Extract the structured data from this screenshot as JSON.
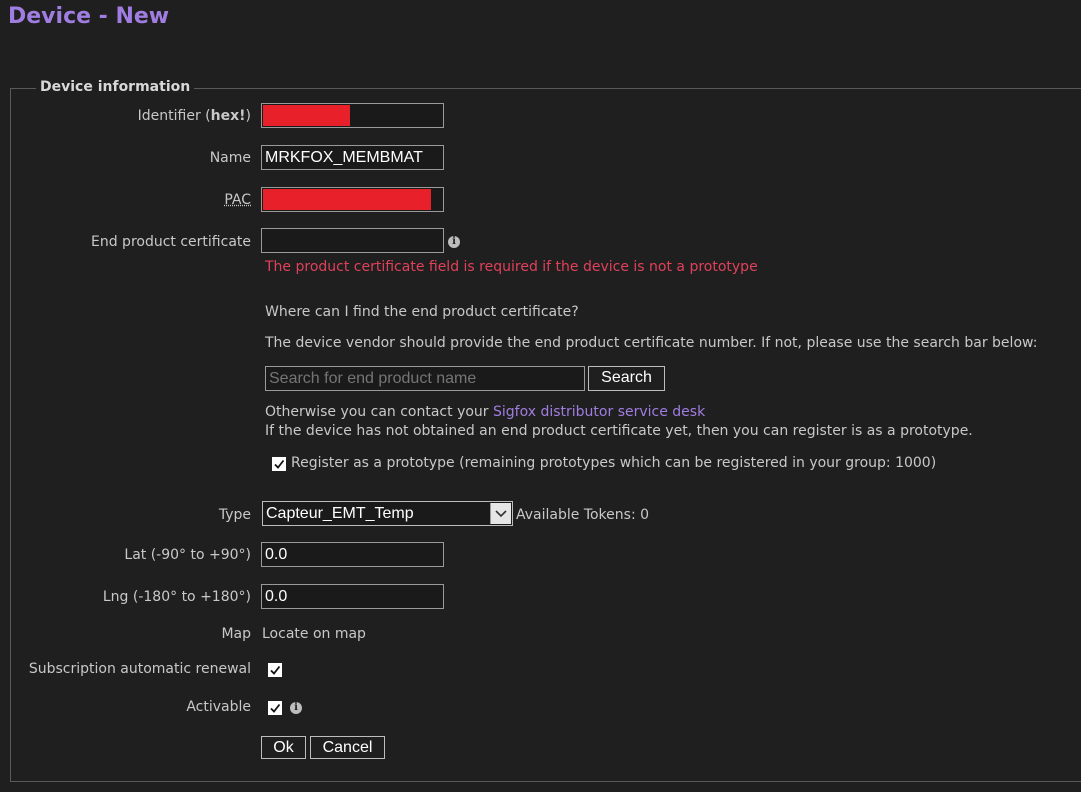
{
  "page": {
    "title": "Device - New"
  },
  "fieldset": {
    "legend": "Device information"
  },
  "identifier": {
    "label_prefix": "Identifier (",
    "label_bold": "hex!",
    "label_suffix": ")",
    "redacted_fraction": 0.48
  },
  "name": {
    "label": "Name",
    "value": "MRKFOX_MEMBMAT"
  },
  "pac": {
    "label": "PAC",
    "redacted_fraction": 0.93
  },
  "certificate": {
    "label": "End product certificate",
    "value": "",
    "error": "The product certificate field is required if the device is not a prototype",
    "help_link": "Where can I find the end product certificate?",
    "help_text": "The device vendor should provide the end product certificate number. If not, please use the search bar below:",
    "search_placeholder": "Search for end product name",
    "search_button": "Search",
    "contact_text": "Otherwise you can contact your ",
    "contact_link": "Sigfox distributor service desk",
    "prototype_note": "If the device has not obtained an end product certificate yet, then you can register is as a prototype.",
    "prototype_checkbox_label": "Register as a prototype (remaining prototypes which can be registered in your group: 1000)",
    "prototype_checked": true
  },
  "type": {
    "label": "Type",
    "selected": "Capteur_EMT_Temp",
    "tokens_text": "Available Tokens: 0"
  },
  "lat": {
    "label": "Lat (-90° to +90°)",
    "value": "0.0"
  },
  "lng": {
    "label": "Lng (-180° to +180°)",
    "value": "0.0"
  },
  "map": {
    "label": "Map",
    "link": "Locate on map"
  },
  "renewal": {
    "label": "Subscription automatic renewal",
    "checked": true
  },
  "activable": {
    "label": "Activable",
    "checked": true
  },
  "actions": {
    "ok": "Ok",
    "cancel": "Cancel"
  },
  "icons": {
    "info": "info-icon",
    "check": "checkmark-icon",
    "dropdown": "chevron-down-icon"
  },
  "colors": {
    "accent": "#a07de0",
    "error": "#e0415a",
    "redaction": "#e8202a",
    "background": "#1f1f1f"
  }
}
